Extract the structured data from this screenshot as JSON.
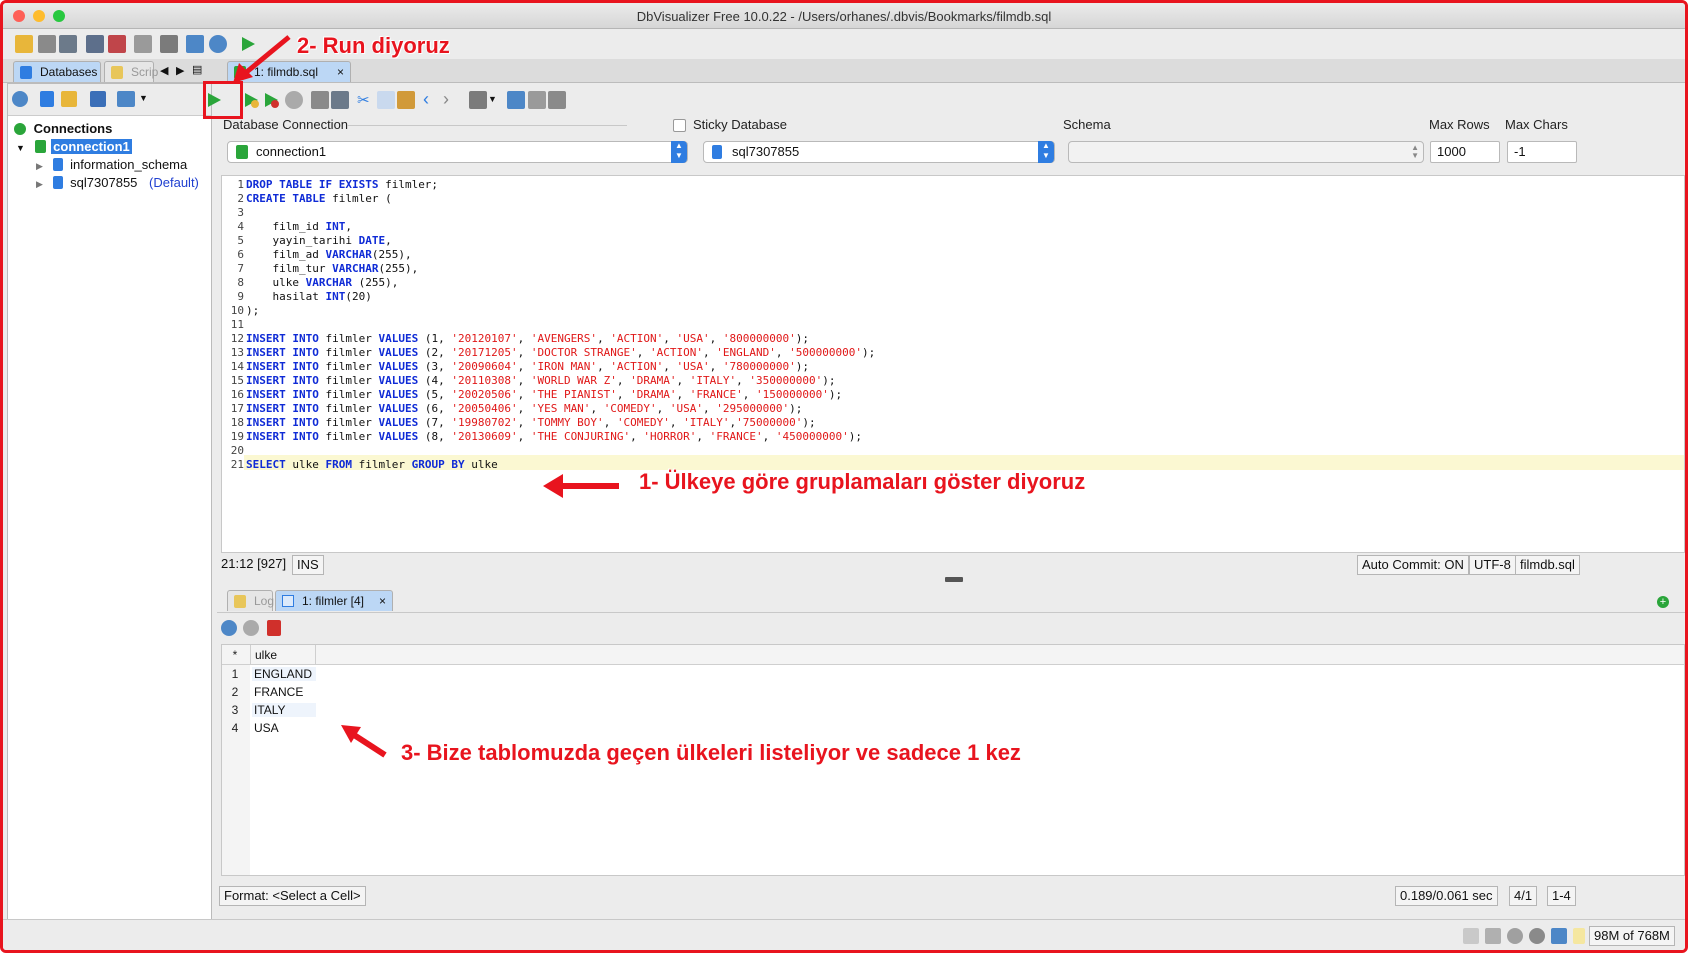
{
  "window": {
    "title": "DbVisualizer Free 10.0.22 - /Users/orhanes/.dbvis/Bookmarks/filmdb.sql"
  },
  "tabs": {
    "databases": "Databases",
    "scripts": "Scrip",
    "sql_tab": "1: filmdb.sql",
    "close": "×"
  },
  "tree": {
    "root": "Connections",
    "connection": "connection1",
    "schema1": "information_schema",
    "schema2": "sql7307855",
    "default_badge": "(Default)"
  },
  "connection_bar": {
    "db_connection_label": "Database Connection",
    "db_connection_value": "connection1",
    "sticky_label": "Sticky Database",
    "database_value": "sql7307855",
    "schema_label": "Schema",
    "schema_value": "",
    "max_rows_label": "Max Rows",
    "max_rows_value": "1000",
    "max_chars_label": "Max Chars",
    "max_chars_value": "-1"
  },
  "editor": {
    "line_numbers": [
      "1",
      "2",
      "3",
      "4",
      "5",
      "6",
      "7",
      "8",
      "9",
      "10",
      "11",
      "12",
      "13",
      "14",
      "15",
      "16",
      "17",
      "18",
      "19",
      "20",
      "21"
    ],
    "cursor_line": 21
  },
  "status": {
    "position": "21:12 [927]",
    "mode": "INS",
    "auto_commit": "Auto Commit: ON",
    "encoding": "UTF-8",
    "file": "filmdb.sql"
  },
  "result_tabs": {
    "log": "Log",
    "result": "1: filmler [4]"
  },
  "grid": {
    "corner": "*",
    "column": "ulke",
    "rows": [
      "ENGLAND",
      "FRANCE",
      "ITALY",
      "USA"
    ],
    "row_numbers": [
      "1",
      "2",
      "3",
      "4"
    ]
  },
  "result_status": {
    "format": "Format: <Select a Cell>",
    "timing": "0.189/0.061 sec",
    "rows": "4/1",
    "range": "1-4"
  },
  "memory": "98M of 768M",
  "annotations": {
    "run": "2- Run diyoruz",
    "group": "1- Ülkeye göre gruplamaları göster diyoruz",
    "result": "3- Bize tablomuzda geçen ülkeleri listeliyor ve sadece 1 kez"
  },
  "colors": {
    "annotation": "#e8141e",
    "keyword": "#0f2bd6",
    "string": "#e01818",
    "selection": "#2f7de1"
  }
}
